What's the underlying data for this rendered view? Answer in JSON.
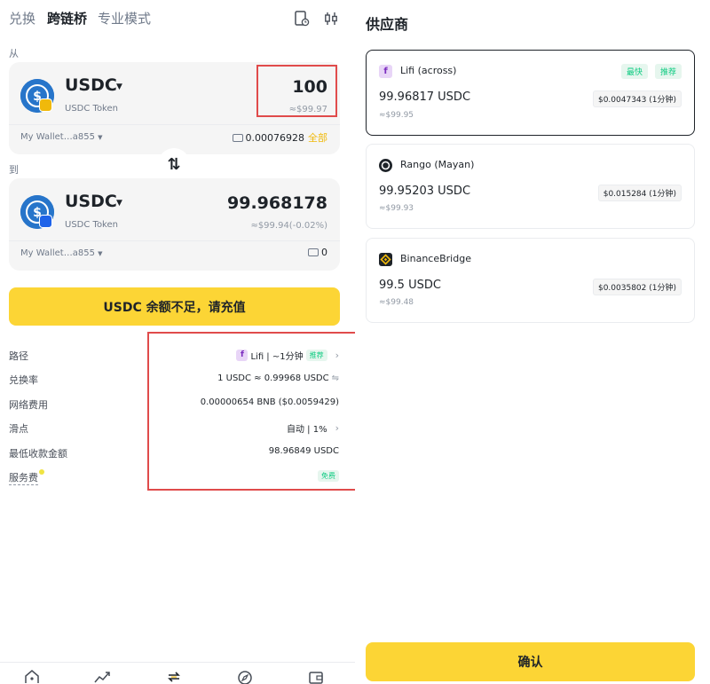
{
  "tabs": [
    "兑换",
    "跨链桥",
    "专业模式"
  ],
  "from_label": "从",
  "to_label": "到",
  "from": {
    "token": "USDC",
    "token_sub": "USDC Token",
    "amount": "100",
    "amount_usd": "≈$99.97",
    "wallet": "My Wallet…a855",
    "balance": "0.00076928",
    "all_label": "全部"
  },
  "to": {
    "token": "USDC",
    "token_sub": "USDC Token",
    "amount": "99.968178",
    "amount_usd": "≈$99.94(-0.02%)",
    "wallet": "My Wallet…a855",
    "balance": "0"
  },
  "topup_button": "USDC 余额不足，请充值",
  "details": {
    "route_label": "路径",
    "route_value": "Lifi | ~1分钟",
    "route_tag": "推荐",
    "rate_label": "兑换率",
    "rate_value": "1 USDC ≈ 0.99968 USDC",
    "network_fee_label": "网络费用",
    "network_fee_value": "0.00000654 BNB ($0.0059429)",
    "slippage_label": "滑点",
    "slippage_value": "自动 | 1%",
    "min_receive_label": "最低收款金额",
    "min_receive_value": "98.96849 USDC",
    "service_fee_label": "服务费",
    "service_fee_value": "免费"
  },
  "providers_title": "供应商",
  "providers": [
    {
      "name": "Lifi (across)",
      "amount": "99.96817 USDC",
      "usd": "≈$99.95",
      "fee": "$0.0047343 (1分钟)",
      "badges": [
        "最快",
        "推荐"
      ]
    },
    {
      "name": "Rango (Mayan)",
      "amount": "99.95203 USDC",
      "usd": "≈$99.93",
      "fee": "$0.015284 (1分钟)"
    },
    {
      "name": "BinanceBridge",
      "amount": "99.5 USDC",
      "usd": "≈$99.48",
      "fee": "$0.0035802 (1分钟)"
    }
  ],
  "confirm_button": "确认",
  "colors": {
    "accent": "#fcd535",
    "usdc_blue": "#2775ca",
    "highlight_red": "#e04b4b",
    "badge_green": "#0ecb81"
  }
}
